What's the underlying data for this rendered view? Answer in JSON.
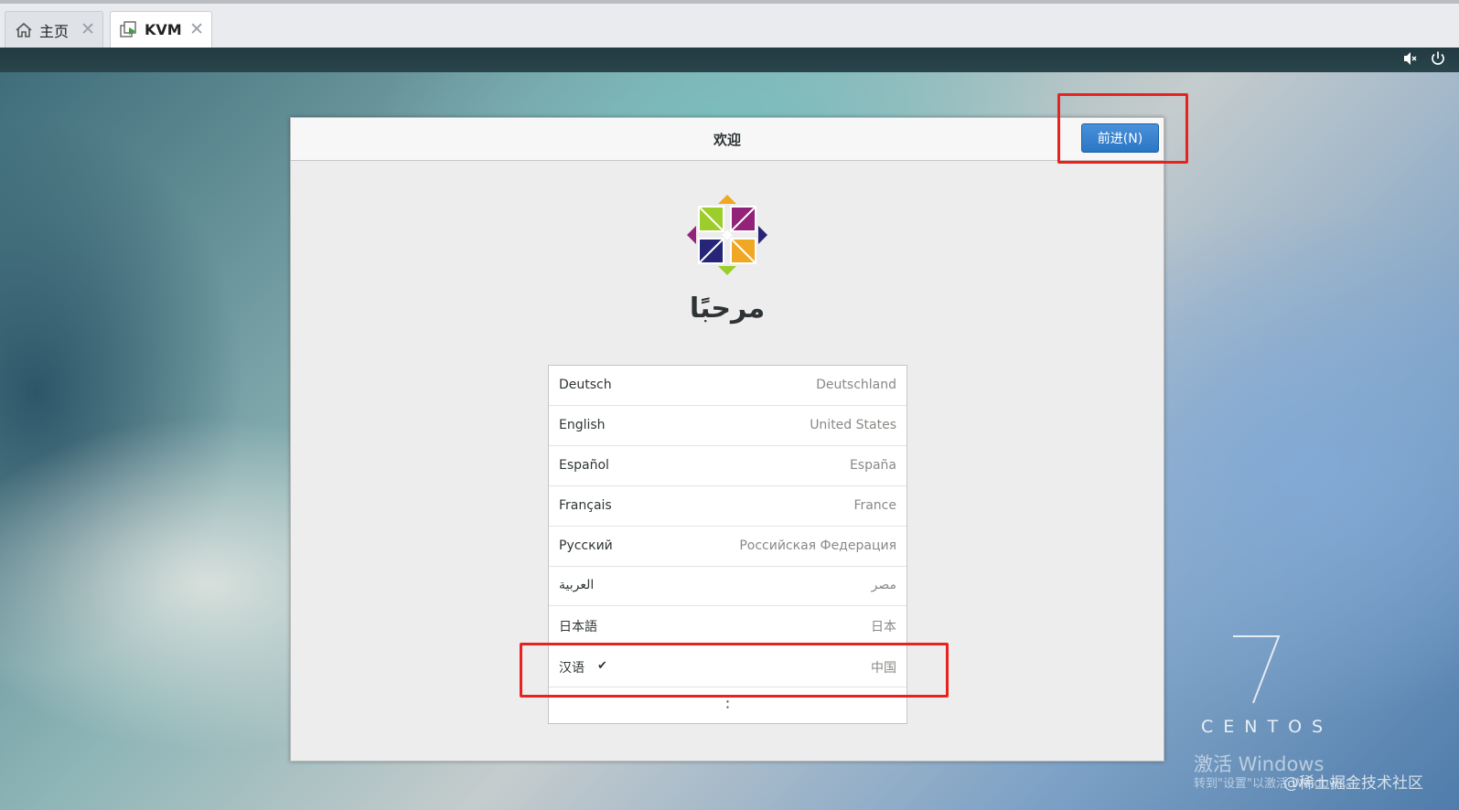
{
  "host_tabs": [
    {
      "label": "主页",
      "icon": "home-icon",
      "close": "✕"
    },
    {
      "label": "KVM",
      "icon": "vm-icon",
      "close": "✕"
    }
  ],
  "guest_bar": {
    "icons": [
      "volume-muted-icon",
      "power-icon"
    ]
  },
  "dialog": {
    "title": "欢迎",
    "next_button": "前进(N)",
    "greeting": "مرحبًا"
  },
  "languages": [
    {
      "name": "Deutsch",
      "region": "Deutschland",
      "selected": false
    },
    {
      "name": "English",
      "region": "United States",
      "selected": false
    },
    {
      "name": "Español",
      "region": "España",
      "selected": false
    },
    {
      "name": "Français",
      "region": "France",
      "selected": false
    },
    {
      "name": "Русский",
      "region": "Российская Федерация",
      "selected": false
    },
    {
      "name": "العربية",
      "region": "مصر",
      "selected": false
    },
    {
      "name": "日本語",
      "region": "日本",
      "selected": false
    },
    {
      "name": "汉语",
      "region": "中国",
      "selected": true,
      "check": "✔"
    }
  ],
  "more_indicator": "⋮",
  "desktop": {
    "brand_number": "7",
    "brand_word": "CENTOS",
    "activate_line1": "激活 Windows",
    "activate_line2": "转到\"设置\"以激活 Windows。",
    "watermark": "@稀土掘金技术社区"
  },
  "colors": {
    "accent": "#2a76c6",
    "highlight": "#e8231f"
  }
}
